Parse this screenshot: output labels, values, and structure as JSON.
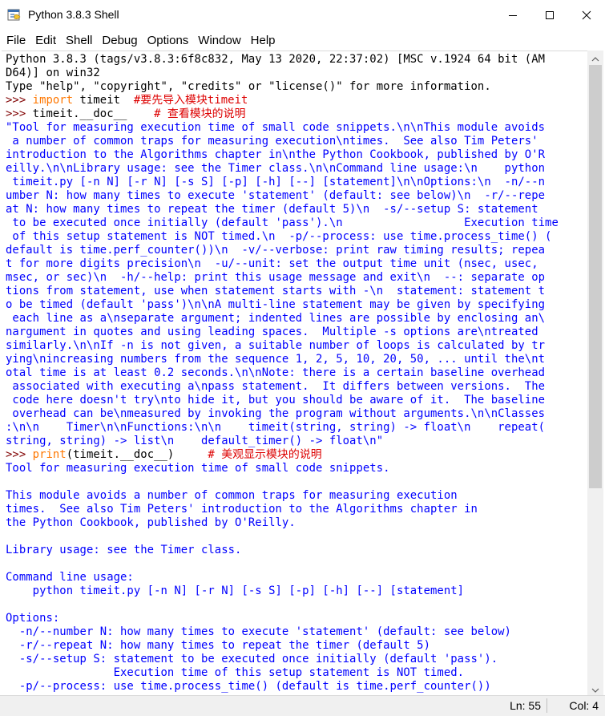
{
  "window": {
    "title": "Python 3.8.3 Shell"
  },
  "menu": [
    "File",
    "Edit",
    "Shell",
    "Debug",
    "Options",
    "Window",
    "Help"
  ],
  "colors": {
    "keyword": "#ff7700",
    "comment": "#dd0000",
    "string": "#00aa00",
    "prompt": "#800000",
    "output": "#0000ff"
  },
  "shell": {
    "lines": [
      [
        {
          "t": "Python 3.8.3 (tags/v3.8.3:6f8c832, May 13 2020, 22:37:02) [MSC v.1924 64 bit (AM",
          "c": ""
        }
      ],
      [
        {
          "t": "D64)] on win32",
          "c": ""
        }
      ],
      [
        {
          "t": "Type \"help\", \"copyright\", \"credits\" or \"license()\" for more information.",
          "c": ""
        }
      ],
      [
        {
          "t": ">>> ",
          "c": "pr"
        },
        {
          "t": "import",
          "c": "kw"
        },
        {
          "t": " timeit  ",
          "c": ""
        },
        {
          "t": "#要先导入模块timeit",
          "c": "cm"
        }
      ],
      [
        {
          "t": ">>> ",
          "c": "pr"
        },
        {
          "t": "timeit.__doc__    ",
          "c": ""
        },
        {
          "t": "# 查看模块的说明",
          "c": "cm"
        }
      ],
      [
        {
          "t": "\"Tool for measuring execution time of small code snippets.\\n\\nThis module avoids",
          "c": "out"
        }
      ],
      [
        {
          "t": " a number of common traps for measuring execution\\ntimes.  See also Tim Peters'",
          "c": "out"
        }
      ],
      [
        {
          "t": "introduction to the Algorithms chapter in\\nthe Python Cookbook, published by O'R",
          "c": "out"
        }
      ],
      [
        {
          "t": "eilly.\\n\\nLibrary usage: see the Timer class.\\n\\nCommand line usage:\\n    python",
          "c": "out"
        }
      ],
      [
        {
          "t": " timeit.py [-n N] [-r N] [-s S] [-p] [-h] [--] [statement]\\n\\nOptions:\\n  -n/--n",
          "c": "out"
        }
      ],
      [
        {
          "t": "umber N: how many times to execute 'statement' (default: see below)\\n  -r/--repe",
          "c": "out"
        }
      ],
      [
        {
          "t": "at N: how many times to repeat the timer (default 5)\\n  -s/--setup S: statement",
          "c": "out"
        }
      ],
      [
        {
          "t": " to be executed once initially (default 'pass').\\n                  Execution time",
          "c": "out"
        }
      ],
      [
        {
          "t": " of this setup statement is NOT timed.\\n  -p/--process: use time.process_time() (",
          "c": "out"
        }
      ],
      [
        {
          "t": "default is time.perf_counter())\\n  -v/--verbose: print raw timing results; repea",
          "c": "out"
        }
      ],
      [
        {
          "t": "t for more digits precision\\n  -u/--unit: set the output time unit (nsec, usec,",
          "c": "out"
        }
      ],
      [
        {
          "t": "msec, or sec)\\n  -h/--help: print this usage message and exit\\n  --: separate op",
          "c": "out"
        }
      ],
      [
        {
          "t": "tions from statement, use when statement starts with -\\n  statement: statement t",
          "c": "out"
        }
      ],
      [
        {
          "t": "o be timed (default 'pass')\\n\\nA multi-line statement may be given by specifying",
          "c": "out"
        }
      ],
      [
        {
          "t": " each line as a\\nseparate argument; indented lines are possible by enclosing an\\",
          "c": "out"
        }
      ],
      [
        {
          "t": "nargument in quotes and using leading spaces.  Multiple -s options are\\ntreated",
          "c": "out"
        }
      ],
      [
        {
          "t": "similarly.\\n\\nIf -n is not given, a suitable number of loops is calculated by tr",
          "c": "out"
        }
      ],
      [
        {
          "t": "ying\\nincreasing numbers from the sequence 1, 2, 5, 10, 20, 50, ... until the\\nt",
          "c": "out"
        }
      ],
      [
        {
          "t": "otal time is at least 0.2 seconds.\\n\\nNote: there is a certain baseline overhead",
          "c": "out"
        }
      ],
      [
        {
          "t": " associated with executing a\\npass statement.  It differs between versions.  The",
          "c": "out"
        }
      ],
      [
        {
          "t": " code here doesn't try\\nto hide it, but you should be aware of it.  The baseline",
          "c": "out"
        }
      ],
      [
        {
          "t": " overhead can be\\nmeasured by invoking the program without arguments.\\n\\nClasses",
          "c": "out"
        }
      ],
      [
        {
          "t": ":\\n\\n    Timer\\n\\nFunctions:\\n\\n    timeit(string, string) -> float\\n    repeat(",
          "c": "out"
        }
      ],
      [
        {
          "t": "string, string) -> list\\n    default_timer() -> float\\n\"",
          "c": "out"
        }
      ],
      [
        {
          "t": ">>> ",
          "c": "pr"
        },
        {
          "t": "print",
          "c": "kw"
        },
        {
          "t": "(timeit.__doc__)     ",
          "c": ""
        },
        {
          "t": "# 美观显示模块的说明",
          "c": "cm"
        }
      ],
      [
        {
          "t": "Tool for measuring execution time of small code snippets.",
          "c": "out"
        }
      ],
      [
        {
          "t": "",
          "c": "out"
        }
      ],
      [
        {
          "t": "This module avoids a number of common traps for measuring execution",
          "c": "out"
        }
      ],
      [
        {
          "t": "times.  See also Tim Peters' introduction to the Algorithms chapter in",
          "c": "out"
        }
      ],
      [
        {
          "t": "the Python Cookbook, published by O'Reilly.",
          "c": "out"
        }
      ],
      [
        {
          "t": "",
          "c": "out"
        }
      ],
      [
        {
          "t": "Library usage: see the Timer class.",
          "c": "out"
        }
      ],
      [
        {
          "t": "",
          "c": "out"
        }
      ],
      [
        {
          "t": "Command line usage:",
          "c": "out"
        }
      ],
      [
        {
          "t": "    python timeit.py [-n N] [-r N] [-s S] [-p] [-h] [--] [statement]",
          "c": "out"
        }
      ],
      [
        {
          "t": "",
          "c": "out"
        }
      ],
      [
        {
          "t": "Options:",
          "c": "out"
        }
      ],
      [
        {
          "t": "  -n/--number N: how many times to execute 'statement' (default: see below)",
          "c": "out"
        }
      ],
      [
        {
          "t": "  -r/--repeat N: how many times to repeat the timer (default 5)",
          "c": "out"
        }
      ],
      [
        {
          "t": "  -s/--setup S: statement to be executed once initially (default 'pass').",
          "c": "out"
        }
      ],
      [
        {
          "t": "                Execution time of this setup statement is NOT timed.",
          "c": "out"
        }
      ],
      [
        {
          "t": "  -p/--process: use time.process_time() (default is time.perf_counter())",
          "c": "out"
        }
      ]
    ]
  },
  "status": {
    "line": "Ln: 55",
    "col": "Col: 4"
  }
}
